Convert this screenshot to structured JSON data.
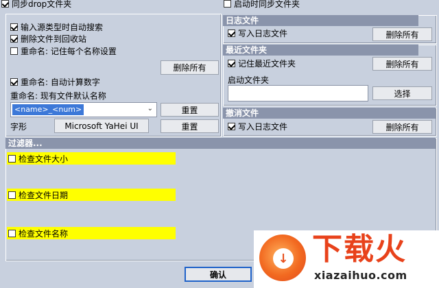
{
  "top": {
    "sync_drop_label": "同步drop文件夹",
    "sync_on_start_label": "启动时同步文件夹"
  },
  "left": {
    "auto_search_label": "输入源类型时自动搜索",
    "delete_to_recycle_label": "删除文件到回收站",
    "remember_each_name_label": "重命名: 记住每个名称设置",
    "delete_all_label": "删除所有",
    "auto_number_label": "重命名: 自动计算数字",
    "default_name_caption": "重命名: 现有文件默认名称",
    "name_template_value": "<name>_<num>",
    "reset_label_1": "重置",
    "font_caption": "字形",
    "font_value": "Microsoft YaHei UI",
    "reset_label_2": "重置"
  },
  "log": {
    "header": "日志文件",
    "write_log_label": "写入日志文件",
    "delete_all_label": "删除所有"
  },
  "recent": {
    "header": "最近文件夹",
    "remember_recent_label": "记住最近文件夹",
    "delete_all_label": "删除所有",
    "startup_folder_caption": "启动文件夹",
    "startup_folder_value": "",
    "choose_label": "选择"
  },
  "undo": {
    "header": "撤消文件",
    "write_log_label": "写入日志文件",
    "delete_all_label": "删除所有"
  },
  "filters": {
    "header": "过滤器...",
    "items": [
      {
        "label": "检查文件大小"
      },
      {
        "label": "检查文件日期"
      },
      {
        "label": "检查文件名称"
      }
    ]
  },
  "footer": {
    "ok_label": "确认"
  },
  "watermark": {
    "brand": "下载火",
    "url": "xiazaihuo.com"
  },
  "colors": {
    "background": "#c8d0de",
    "header": "#8a94ab",
    "highlight": "#ffff00",
    "brand": "#e8421b"
  }
}
